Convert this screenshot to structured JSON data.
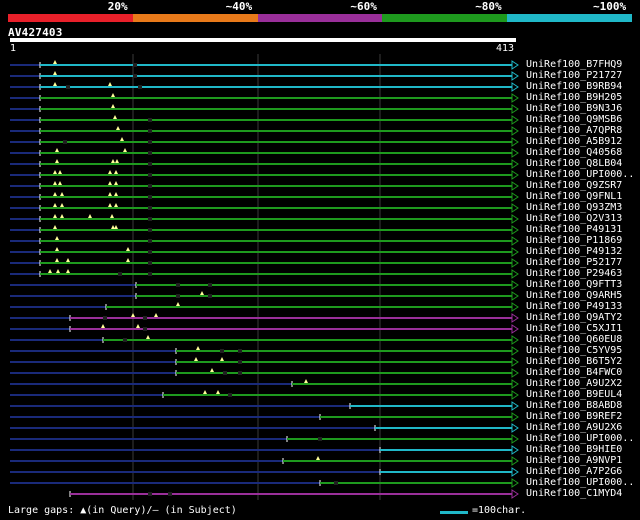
{
  "legend": {
    "segments": [
      {
        "label": "20%",
        "color": "#e8202a"
      },
      {
        "label": "~40%",
        "color": "#e87a1a"
      },
      {
        "label": "~60%",
        "color": "#9a2f9a"
      },
      {
        "label": "~80%",
        "color": "#1e9a1e"
      },
      {
        "label": "~100%",
        "color": "#20b8c8"
      }
    ]
  },
  "query": {
    "title": "AV427403",
    "start_label": "1",
    "end_label": "413"
  },
  "colors": {
    "background": "#000000",
    "stub_line": "#1a2a7a",
    "gap_marker": "#ffff99",
    "grid": "#3a3a3a"
  },
  "hits": [
    {
      "label": "UniRef100_B7FHQ9",
      "color": "#20b8c8"
    },
    {
      "label": "UniRef100_P21727",
      "color": "#20b8c8"
    },
    {
      "label": "UniRef100_B9RB94",
      "color": "#20b8c8"
    },
    {
      "label": "UniRef100_B9H205",
      "color": "#1e9a1e"
    },
    {
      "label": "UniRef100_B9N3J6",
      "color": "#1e9a1e"
    },
    {
      "label": "UniRef100_Q9MSB6",
      "color": "#1e9a1e"
    },
    {
      "label": "UniRef100_A7QPR8",
      "color": "#1e9a1e"
    },
    {
      "label": "UniRef100_A5B912",
      "color": "#1e9a1e"
    },
    {
      "label": "UniRef100_Q40568",
      "color": "#1e9a1e"
    },
    {
      "label": "UniRef100_Q8LB04",
      "color": "#1e9a1e"
    },
    {
      "label": "UniRef100_UPI000..",
      "color": "#1e9a1e"
    },
    {
      "label": "UniRef100_Q9ZSR7",
      "color": "#1e9a1e"
    },
    {
      "label": "UniRef100_Q9FNL1",
      "color": "#1e9a1e"
    },
    {
      "label": "UniRef100_Q93ZM3",
      "color": "#1e9a1e"
    },
    {
      "label": "UniRef100_Q2V313",
      "color": "#1e9a1e"
    },
    {
      "label": "UniRef100_P49131",
      "color": "#1e9a1e"
    },
    {
      "label": "UniRef100_P11869",
      "color": "#1e9a1e"
    },
    {
      "label": "UniRef100_P49132",
      "color": "#1e9a1e"
    },
    {
      "label": "UniRef100_P52177",
      "color": "#1e9a1e"
    },
    {
      "label": "UniRef100_P29463",
      "color": "#1e9a1e"
    },
    {
      "label": "UniRef100_Q9FTT3",
      "color": "#1e9a1e"
    },
    {
      "label": "UniRef100_Q9ARH5",
      "color": "#1e9a1e"
    },
    {
      "label": "UniRef100_P49133",
      "color": "#1e9a1e"
    },
    {
      "label": "UniRef100_Q9ATY2",
      "color": "#9a2f9a"
    },
    {
      "label": "UniRef100_C5XJI1",
      "color": "#9a2f9a"
    },
    {
      "label": "UniRef100_Q60EU8",
      "color": "#1e9a1e"
    },
    {
      "label": "UniRef100_C5YV95",
      "color": "#1e9a1e"
    },
    {
      "label": "UniRef100_B6T5Y2",
      "color": "#1e9a1e"
    },
    {
      "label": "UniRef100_B4FWC0",
      "color": "#1e9a1e"
    },
    {
      "label": "UniRef100_A9U2X2",
      "color": "#1e9a1e"
    },
    {
      "label": "UniRef100_B9EUL4",
      "color": "#1e9a1e"
    },
    {
      "label": "UniRef100_B8ABD8",
      "color": "#20b8c8"
    },
    {
      "label": "UniRef100_B9REF2",
      "color": "#1e9a1e"
    },
    {
      "label": "UniRef100_A9U2X6",
      "color": "#20b8c8"
    },
    {
      "label": "UniRef100_UPI000..",
      "color": "#1e9a1e"
    },
    {
      "label": "UniRef100_B9HIE0",
      "color": "#20b8c8"
    },
    {
      "label": "UniRef100_A9NVP1",
      "color": "#1e9a1e"
    },
    {
      "label": "UniRef100_A7P2G6",
      "color": "#20b8c8"
    },
    {
      "label": "UniRef100_UPI000..",
      "color": "#1e9a1e"
    },
    {
      "label": "UniRef100_C1MYD4",
      "color": "#9a2f9a"
    }
  ],
  "footer": {
    "gaps_text": "Large gaps: ▲(in Query)/– (in Subject)",
    "scale_text": "=100char.",
    "scale_color": "#20b8c8"
  }
}
